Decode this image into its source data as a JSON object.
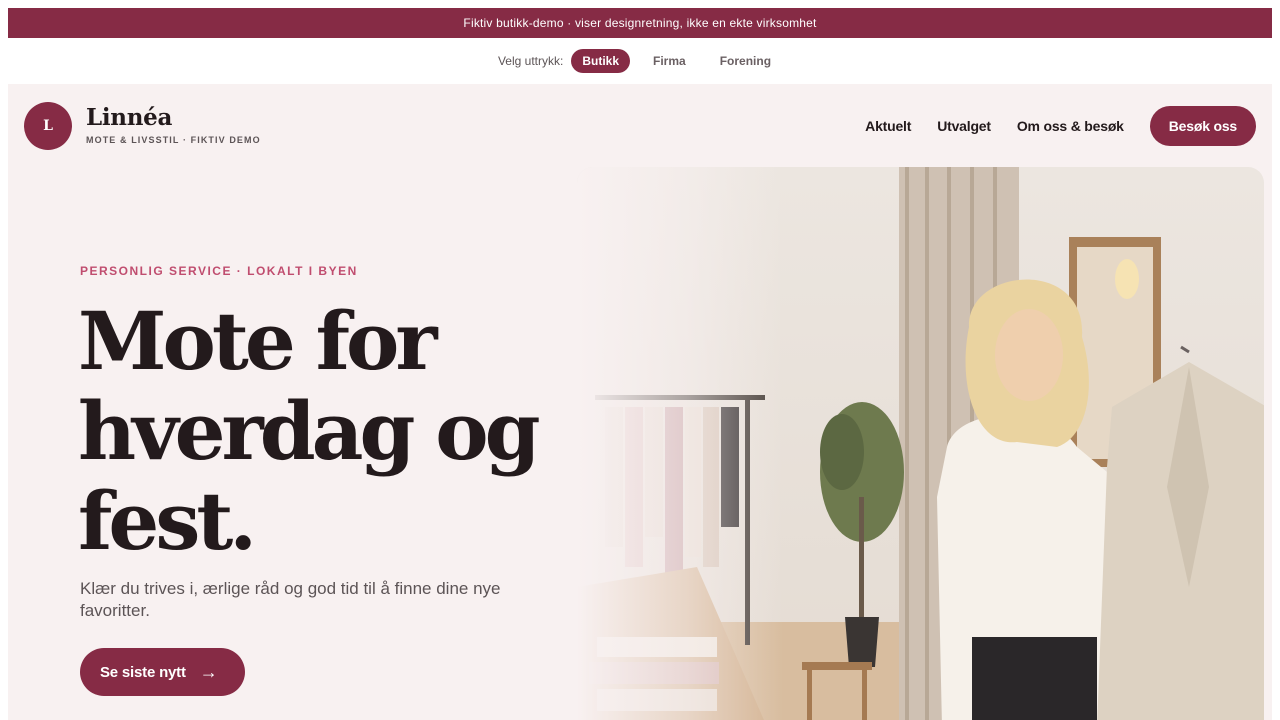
{
  "banner": {
    "text": "Fiktiv butikk-demo · viser designretning, ikke en ekte virksomhet"
  },
  "switcher": {
    "label": "Velg uttrykk:",
    "options": [
      {
        "label": "Butikk",
        "active": true
      },
      {
        "label": "Firma",
        "active": false
      },
      {
        "label": "Forening",
        "active": false
      }
    ]
  },
  "header": {
    "logo_letter": "L",
    "brand_name": "Linnéa",
    "tagline": "MOTE & LIVSSTIL · FIKTIV DEMO",
    "nav": [
      "Aktuelt",
      "Utvalget",
      "Om oss & besøk"
    ],
    "cta": "Besøk oss"
  },
  "hero": {
    "eyebrow": "PERSONLIG SERVICE · LOKALT I BYEN",
    "title_lines": [
      "Mote for",
      "hverdag og",
      "fest."
    ],
    "subtitle": "Klær du trives i, ærlige råd og god tid til å finne dine nye favoritter.",
    "button": "Se siste nytt",
    "button_arrow": "→"
  },
  "colors": {
    "brand": "#862b45",
    "page_bg": "#f8f1f1",
    "accent_text": "#c04d6f",
    "heading": "#231a1c",
    "muted": "#5c5456"
  }
}
